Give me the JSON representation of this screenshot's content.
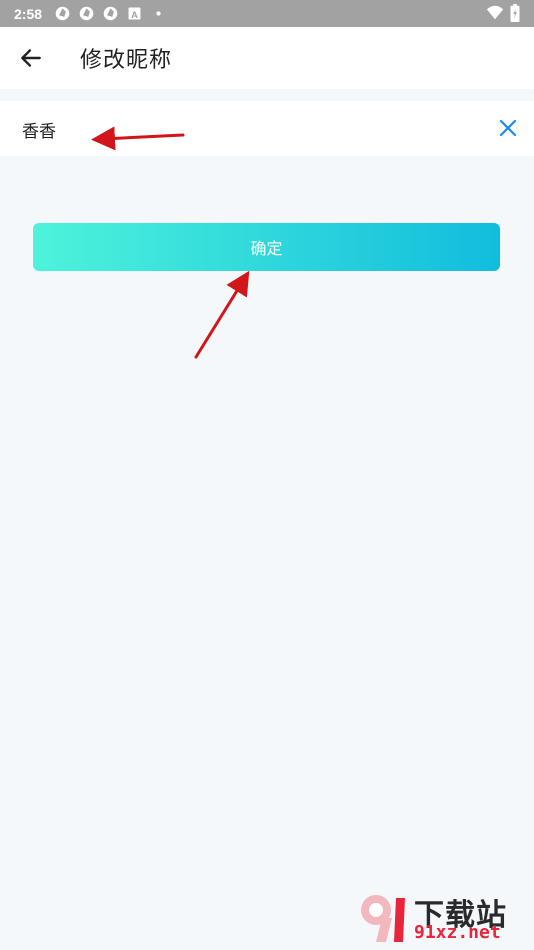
{
  "status_bar": {
    "time": "2:58",
    "icons": [
      "aperture-icon",
      "aperture-icon",
      "aperture-icon",
      "a-box-icon",
      "dot-icon",
      "wifi-icon",
      "battery-icon"
    ]
  },
  "toolbar": {
    "title": "修改昵称",
    "back_icon": "arrow-left-icon"
  },
  "nickname": {
    "value": "香香",
    "clear_icon": "close-icon",
    "clear_color": "#1e88e5"
  },
  "confirm": {
    "label": "确定",
    "gradient_start": "#4ef3db",
    "gradient_end": "#12bcdd"
  },
  "annotations": {
    "arrow_color": "#d0161b"
  },
  "watermark": {
    "text": "下载站",
    "domain": "91xz.net"
  }
}
